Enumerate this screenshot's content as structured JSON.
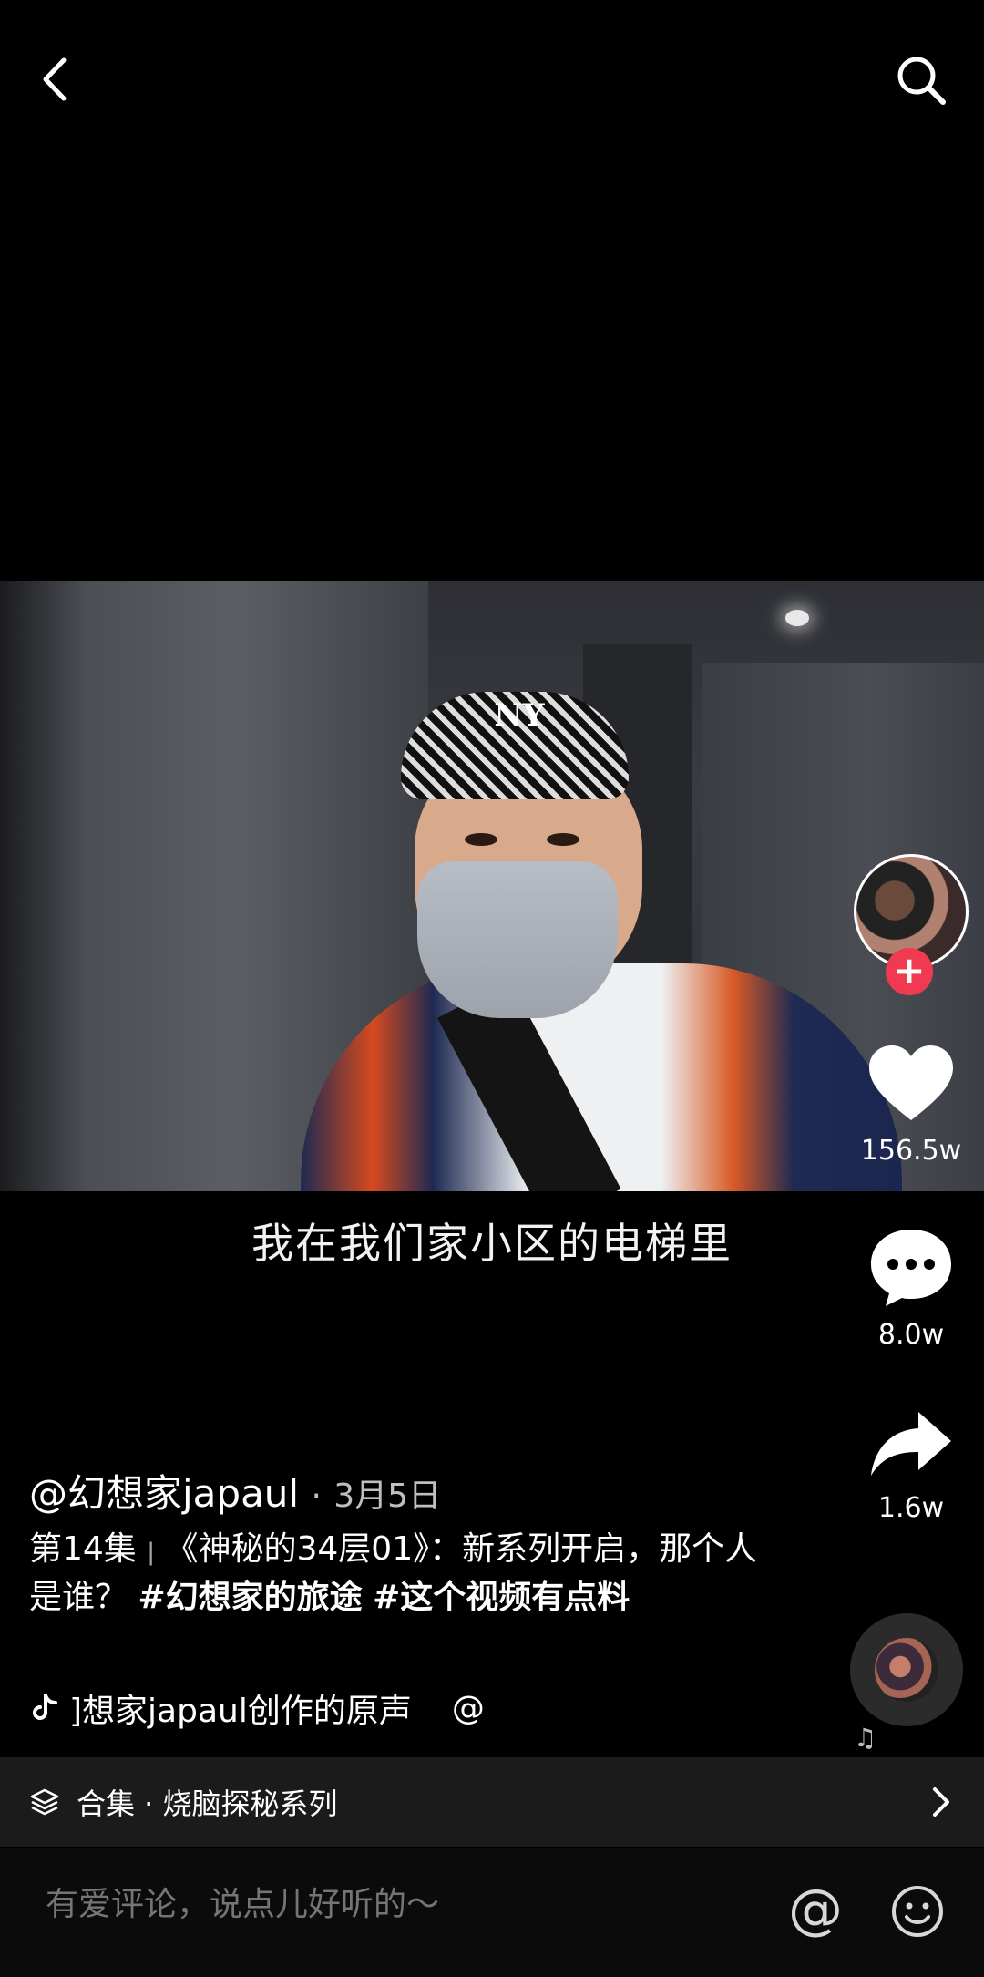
{
  "video": {
    "subtitle": "我在我们家小区的电梯里",
    "cap_logo": "NY"
  },
  "author": {
    "handle": "@幻想家japaul",
    "date_sep": "·",
    "date": "3月5日"
  },
  "description": {
    "episode": "第14集",
    "sep": "|",
    "text": "《神秘的34层01》：新系列开启，那个人是谁？ ",
    "tag1": "#幻想家的旅途",
    "tag2": "#这个视频有点料"
  },
  "music": {
    "label": "]想家japaul创作的原声",
    "at": "@"
  },
  "stats": {
    "likes": "156.5w",
    "comments": "8.0w",
    "shares": "1.6w"
  },
  "follow": {
    "label": "+"
  },
  "collection": {
    "label": "合集 · 烧脑探秘系列"
  },
  "comment_bar": {
    "placeholder": "有爱评论，说点儿好听的～",
    "at_label": "@"
  },
  "colors": {
    "background": "#000000",
    "follow": "#f03a52",
    "collection_bar": "#1b1b1b"
  },
  "icons": [
    "back-icon",
    "search-icon",
    "heart-icon",
    "comment-icon",
    "share-icon",
    "tiktok-note-icon",
    "music-note-icon",
    "layers-icon",
    "chevron-right-icon",
    "emoji-icon"
  ]
}
